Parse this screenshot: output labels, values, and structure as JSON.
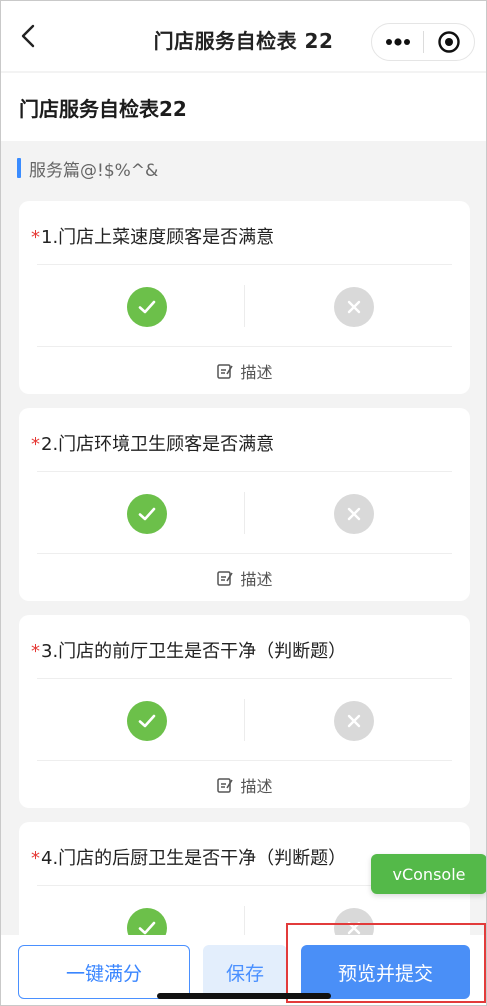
{
  "navbar": {
    "title": "门店服务自检表 22",
    "back_icon": "chevron-left-icon",
    "menu_icon": "more-dots-icon",
    "close_icon": "target-circle-icon"
  },
  "header": {
    "title": "门店服务自检表22"
  },
  "section": {
    "label": "服务篇@!$%^&",
    "accent": "#3a8cff"
  },
  "questions": [
    {
      "required": "*",
      "title": "1.门店上菜速度顾客是否满意",
      "desc_label": "描述"
    },
    {
      "required": "*",
      "title": "2.门店环境卫生顾客是否满意",
      "desc_label": "描述"
    },
    {
      "required": "*",
      "title": "3.门店的前厅卫生是否干净（判断题）",
      "desc_label": "描述"
    },
    {
      "required": "*",
      "title": "4.门店的后厨卫生是否干净（判断题）",
      "desc_label": "描述"
    }
  ],
  "colors": {
    "yes": "#6cc04a",
    "no": "#d9d9d9",
    "primary": "#4a8ff7",
    "required": "#e53935"
  },
  "vconsole": {
    "label": "vConsole"
  },
  "bottom": {
    "full_score": "一键满分",
    "save": "保存",
    "preview_submit": "预览并提交"
  }
}
